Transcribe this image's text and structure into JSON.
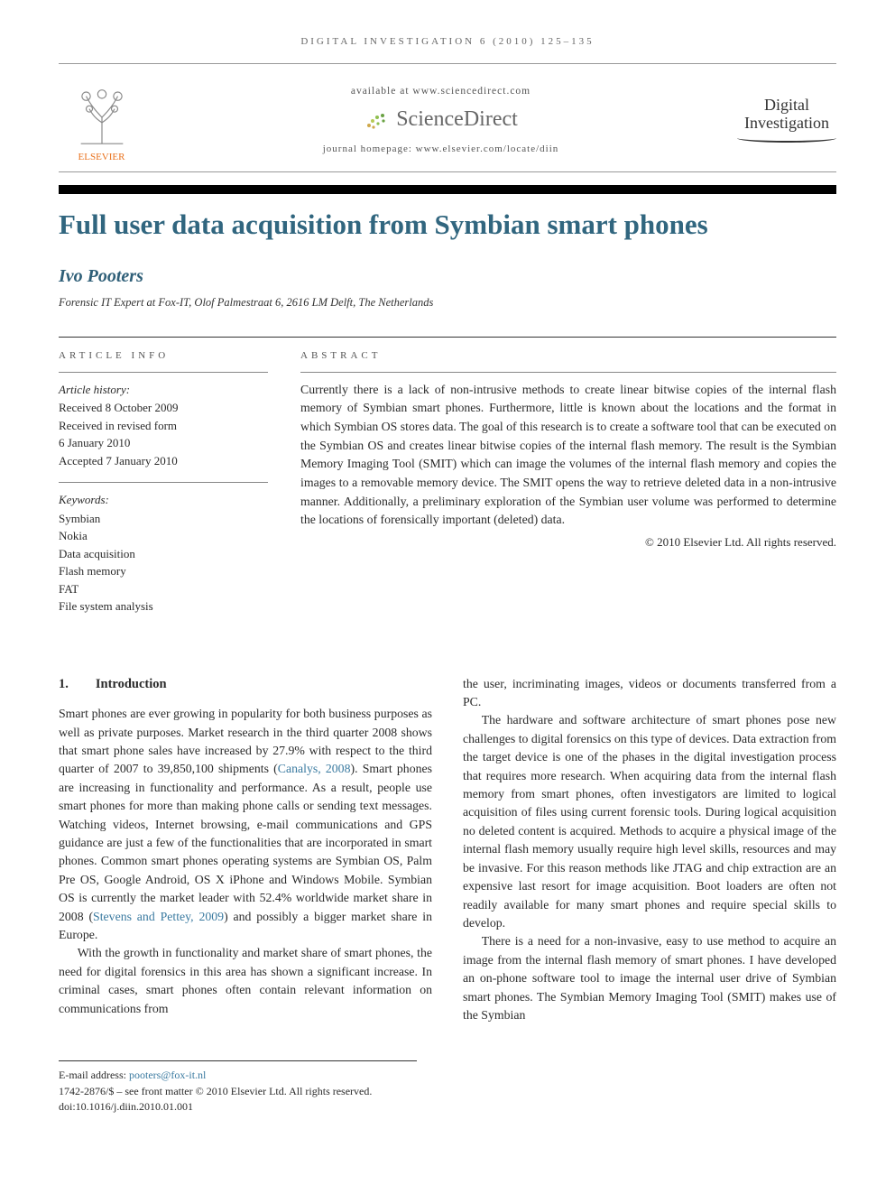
{
  "running_head": "DIGITAL INVESTIGATION 6 (2010) 125–135",
  "header": {
    "publisher_left": "ELSEVIER",
    "available_at": "available at www.sciencedirect.com",
    "sd_brand": "ScienceDirect",
    "homepage": "journal homepage: www.elsevier.com/locate/diin",
    "journal_right_line1": "Digital",
    "journal_right_line2": "Investigation"
  },
  "title": "Full user data acquisition from Symbian smart phones",
  "author": "Ivo Pooters",
  "affiliation": "Forensic IT Expert at Fox-IT, Olof Palmestraat 6, 2616 LM Delft, The Netherlands",
  "article_info_head": "ARTICLE INFO",
  "abstract_head": "ABSTRACT",
  "history": {
    "head": "Article history:",
    "received": "Received 8 October 2009",
    "revised1": "Received in revised form",
    "revised2": "6 January 2010",
    "accepted": "Accepted 7 January 2010"
  },
  "keywords": {
    "head": "Keywords:",
    "items": [
      "Symbian",
      "Nokia",
      "Data acquisition",
      "Flash memory",
      "FAT",
      "File system analysis"
    ]
  },
  "abstract": "Currently there is a lack of non-intrusive methods to create linear bitwise copies of the internal flash memory of Symbian smart phones. Furthermore, little is known about the locations and the format in which Symbian OS stores data. The goal of this research is to create a software tool that can be executed on the Symbian OS and creates linear bitwise copies of the internal flash memory. The result is the Symbian Memory Imaging Tool (SMIT) which can image the volumes of the internal flash memory and copies the images to a removable memory device. The SMIT opens the way to retrieve deleted data in a non-intrusive manner. Additionally, a preliminary exploration of the Symbian user volume was performed to determine the locations of forensically important (deleted) data.",
  "copyright": "© 2010 Elsevier Ltd. All rights reserved.",
  "section1": {
    "num": "1.",
    "title": "Introduction"
  },
  "body": {
    "p1a": "Smart phones are ever growing in popularity for both business purposes as well as private purposes. Market research in the third quarter 2008 shows that smart phone sales have increased by 27.9% with respect to the third quarter of 2007 to 39,850,100 shipments (",
    "cite1": "Canalys, 2008",
    "p1b": "). Smart phones are increasing in functionality and performance. As a result, people use smart phones for more than making phone calls or sending text messages. Watching videos, Internet browsing, e-mail communications and GPS guidance are just a few of the functionalities that are incorporated in smart phones. Common smart phones operating systems are Symbian OS, Palm Pre OS, Google Android, OS X iPhone and Windows Mobile. Symbian OS is currently the market leader with 52.4% worldwide market share in 2008 (",
    "cite2": "Stevens and Pettey, 2009",
    "p1c": ") and possibly a bigger market share in Europe.",
    "p2": "With the growth in functionality and market share of smart phones, the need for digital forensics in this area has shown a significant increase. In criminal cases, smart phones often contain relevant information on communications from",
    "p3": "the user, incriminating images, videos or documents transferred from a PC.",
    "p4": "The hardware and software architecture of smart phones pose new challenges to digital forensics on this type of devices. Data extraction from the target device is one of the phases in the digital investigation process that requires more research. When acquiring data from the internal flash memory from smart phones, often investigators are limited to logical acquisition of files using current forensic tools. During logical acquisition no deleted content is acquired. Methods to acquire a physical image of the internal flash memory usually require high level skills, resources and may be invasive. For this reason methods like JTAG and chip extraction are an expensive last resort for image acquisition. Boot loaders are often not readily available for many smart phones and require special skills to develop.",
    "p5": "There is a need for a non-invasive, easy to use method to acquire an image from the internal flash memory of smart phones. I have developed an on-phone software tool to image the internal user drive of Symbian smart phones. The Symbian Memory Imaging Tool (SMIT) makes use of the Symbian"
  },
  "footnotes": {
    "email_label": "E-mail address: ",
    "email": "pooters@fox-it.nl",
    "front_matter": "1742-2876/$ – see front matter © 2010 Elsevier Ltd. All rights reserved.",
    "doi": "doi:10.1016/j.diin.2010.01.001"
  }
}
